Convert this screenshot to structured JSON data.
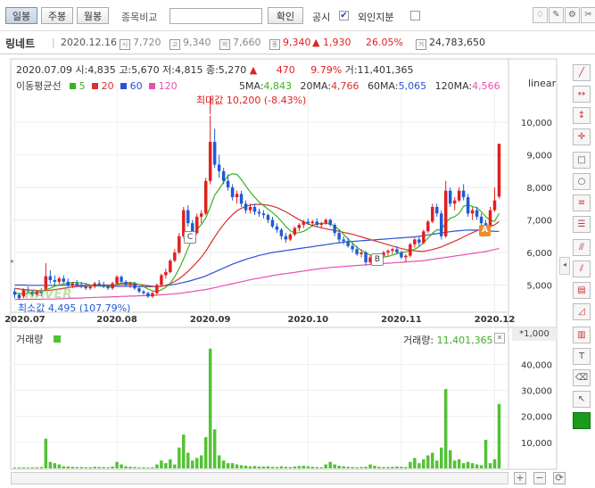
{
  "toolbar": {
    "period_buttons": [
      "일봉",
      "주봉",
      "월봉"
    ],
    "compare_label": "종목비교",
    "confirm_label": "확인",
    "disclosure_label": "공시",
    "foreign_label": "외인지분",
    "check_mark": "✔"
  },
  "info": {
    "name": "링네트",
    "date": "2020.12.16",
    "open": "7,720",
    "high": "9,340",
    "low": "7,660",
    "close": "9,340",
    "change": "▲ 1,930",
    "change_pct": "26.05%",
    "volume": "24,783,650",
    "icon_open": "시",
    "icon_high": "고",
    "icon_low": "저",
    "icon_volume": "거"
  },
  "legend": {
    "row1": {
      "date": "2020.07.09",
      "open_label": "시:",
      "open": "4,835",
      "high_label": "고:",
      "high": "5,670",
      "low_label": "저:",
      "low": "4,815",
      "close_label": "종:",
      "close": "5,270",
      "arrow": "▲",
      "change": "470",
      "change_pct": "9.79%",
      "volume_label": "거:",
      "volume": "11,401,365"
    },
    "ma_title": "이동평균선",
    "ma_items": [
      {
        "label": "5",
        "color": "#3cb021"
      },
      {
        "label": "20",
        "color": "#d83030"
      },
      {
        "label": "60",
        "color": "#2b50d8"
      },
      {
        "label": "120",
        "color": "#e84fb2"
      }
    ],
    "ma_values": [
      {
        "label": "5MA:",
        "value": "4,843",
        "color": "#3cb021"
      },
      {
        "label": "20MA:",
        "value": "4,766",
        "color": "#d83030"
      },
      {
        "label": "60MA:",
        "value": "5,065",
        "color": "#2b50d8"
      },
      {
        "label": "120MA:",
        "value": "4,566",
        "color": "#e84fb2"
      }
    ],
    "scale_type": "linear"
  },
  "annotations": {
    "max_label": "최대값 10,200 (-8.43%)",
    "min_label": "최소값 4,495 (107.79%)",
    "marker_a": "A",
    "marker_b": "B",
    "marker_c": "C",
    "watermark": "NAVER"
  },
  "volume_panel": {
    "title": "거래량",
    "value_label": "거래량:",
    "value": "11,401,365",
    "unit": "*1,000",
    "close_mark": "✕"
  },
  "colors": {
    "up": "#e02020",
    "down": "#1e5bd6",
    "ma5": "#3cb021",
    "ma20": "#d83030",
    "ma60": "#2b50d8",
    "ma120": "#e84fb2",
    "volume": "#52c234"
  },
  "chart_data": {
    "type": "candlestick",
    "x_tick_labels": [
      "2020.07",
      "2020.08",
      "2020.09",
      "2020.10",
      "2020.11",
      "2020.12"
    ],
    "x_tick_index": [
      0,
      23,
      44,
      66,
      87,
      108
    ],
    "y_ticks": [
      5000,
      6000,
      7000,
      8000,
      9000,
      10000
    ],
    "y_tick_labels": [
      "5,000",
      "6,000",
      "7,000",
      "8,000",
      "9,000",
      "10,000"
    ],
    "ylim": [
      4300,
      10800
    ],
    "candles": [
      [
        4800,
        4900,
        4600,
        4700
      ],
      [
        4700,
        4750,
        4550,
        4600
      ],
      [
        4650,
        4900,
        4600,
        4850
      ],
      [
        4850,
        4950,
        4750,
        4800
      ],
      [
        4800,
        4850,
        4650,
        4700
      ],
      [
        4700,
        4850,
        4650,
        4800
      ],
      [
        4800,
        4900,
        4650,
        4750
      ],
      [
        4835,
        5670,
        4815,
        5270
      ],
      [
        5270,
        5450,
        5050,
        5150
      ],
      [
        5150,
        5300,
        5000,
        5100
      ],
      [
        5100,
        5250,
        5000,
        5200
      ],
      [
        5200,
        5300,
        5050,
        5100
      ],
      [
        5100,
        5200,
        4950,
        5000
      ],
      [
        5000,
        5100,
        4900,
        5050
      ],
      [
        5050,
        5150,
        4950,
        5000
      ],
      [
        5000,
        5100,
        4900,
        4950
      ],
      [
        4950,
        5050,
        4850,
        4900
      ],
      [
        4900,
        5000,
        4850,
        4950
      ],
      [
        4950,
        5100,
        4900,
        5050
      ],
      [
        5050,
        5150,
        4950,
        5000
      ],
      [
        5000,
        5100,
        4900,
        4950
      ],
      [
        4950,
        5000,
        4850,
        4900
      ],
      [
        4900,
        5100,
        4850,
        5050
      ],
      [
        5050,
        5300,
        5000,
        5250
      ],
      [
        5250,
        5300,
        5050,
        5100
      ],
      [
        5100,
        5150,
        4950,
        5000
      ],
      [
        5000,
        5100,
        4900,
        5050
      ],
      [
        5050,
        5100,
        4850,
        4900
      ],
      [
        4900,
        4950,
        4750,
        4800
      ],
      [
        4800,
        4850,
        4700,
        4750
      ],
      [
        4750,
        4800,
        4600,
        4650
      ],
      [
        4650,
        4800,
        4600,
        4750
      ],
      [
        4750,
        5050,
        4700,
        5000
      ],
      [
        5000,
        5350,
        4950,
        5300
      ],
      [
        5300,
        5500,
        5200,
        5400
      ],
      [
        5400,
        5800,
        5350,
        5750
      ],
      [
        5750,
        6100,
        5700,
        6000
      ],
      [
        6000,
        6600,
        5950,
        6500
      ],
      [
        6500,
        7400,
        6450,
        7300
      ],
      [
        7300,
        7450,
        6800,
        6900
      ],
      [
        6900,
        7000,
        6500,
        6600
      ],
      [
        6600,
        7200,
        6550,
        7100
      ],
      [
        7100,
        7300,
        6900,
        7200
      ],
      [
        7200,
        8300,
        7150,
        8200
      ],
      [
        8200,
        10200,
        8100,
        9400
      ],
      [
        9400,
        9800,
        8600,
        8700
      ],
      [
        8700,
        9000,
        8300,
        8500
      ],
      [
        8500,
        8600,
        8100,
        8200
      ],
      [
        8200,
        8400,
        7900,
        8000
      ],
      [
        8000,
        8100,
        7600,
        7700
      ],
      [
        7700,
        7900,
        7500,
        7800
      ],
      [
        7800,
        7900,
        7400,
        7500
      ],
      [
        7500,
        7600,
        7200,
        7300
      ],
      [
        7300,
        7500,
        7200,
        7400
      ],
      [
        7400,
        7500,
        7150,
        7250
      ],
      [
        7250,
        7350,
        7100,
        7200
      ],
      [
        7200,
        7300,
        7050,
        7150
      ],
      [
        7150,
        7200,
        6900,
        7000
      ],
      [
        7000,
        7100,
        6750,
        6800
      ],
      [
        6800,
        6900,
        6600,
        6700
      ],
      [
        6700,
        6750,
        6400,
        6500
      ],
      [
        6500,
        6600,
        6300,
        6400
      ],
      [
        6400,
        6600,
        6350,
        6550
      ],
      [
        6550,
        6800,
        6500,
        6750
      ],
      [
        6750,
        6900,
        6650,
        6850
      ],
      [
        6850,
        7000,
        6750,
        6950
      ],
      [
        6950,
        7050,
        6850,
        6900
      ],
      [
        6900,
        7000,
        6800,
        6950
      ],
      [
        6950,
        7050,
        6800,
        6850
      ],
      [
        6850,
        6950,
        6750,
        6900
      ],
      [
        6900,
        7050,
        6850,
        7000
      ],
      [
        7000,
        7050,
        6800,
        6850
      ],
      [
        6850,
        6900,
        6500,
        6600
      ],
      [
        6600,
        6700,
        6300,
        6400
      ],
      [
        6400,
        6500,
        6250,
        6350
      ],
      [
        6350,
        6450,
        6150,
        6200
      ],
      [
        6200,
        6300,
        6000,
        6100
      ],
      [
        6100,
        6200,
        5900,
        5950
      ],
      [
        5950,
        6100,
        5850,
        6000
      ],
      [
        6000,
        6050,
        5600,
        5700
      ],
      [
        5700,
        5900,
        5650,
        5850
      ],
      [
        5850,
        5950,
        5750,
        5800
      ],
      [
        5800,
        5950,
        5750,
        5900
      ],
      [
        5900,
        6050,
        5850,
        6000
      ],
      [
        6000,
        6100,
        5900,
        6050
      ],
      [
        6050,
        6150,
        5950,
        6100
      ],
      [
        6100,
        6200,
        5950,
        6000
      ],
      [
        6000,
        6050,
        5800,
        5850
      ],
      [
        5850,
        5950,
        5700,
        5900
      ],
      [
        5900,
        6300,
        5850,
        6250
      ],
      [
        6250,
        6450,
        6150,
        6400
      ],
      [
        6400,
        6500,
        6200,
        6300
      ],
      [
        6300,
        6700,
        6250,
        6650
      ],
      [
        6650,
        7000,
        6600,
        6950
      ],
      [
        6950,
        7500,
        6900,
        7400
      ],
      [
        7400,
        7500,
        7100,
        7200
      ],
      [
        7200,
        7300,
        6400,
        6500
      ],
      [
        6500,
        8200,
        6450,
        7900
      ],
      [
        7900,
        8000,
        7400,
        7500
      ],
      [
        7500,
        7700,
        7300,
        7600
      ],
      [
        7600,
        8000,
        7550,
        7900
      ],
      [
        7900,
        8100,
        7600,
        7700
      ],
      [
        7700,
        7800,
        7100,
        7200
      ],
      [
        7200,
        7400,
        7000,
        7300
      ],
      [
        7300,
        7400,
        7000,
        7100
      ],
      [
        7100,
        7200,
        6850,
        6900
      ],
      [
        6900,
        7000,
        6700,
        6800
      ],
      [
        6800,
        7400,
        6750,
        7300
      ],
      [
        7300,
        8000,
        7250,
        7600
      ],
      [
        7720,
        9340,
        7660,
        9340
      ]
    ],
    "ma5": [
      4750,
      4740,
      4730,
      4750,
      4760,
      4780,
      4800,
      4850,
      4900,
      4960,
      5000,
      5030,
      5060,
      5080,
      5080,
      5060,
      5040,
      5000,
      4990,
      4980,
      4970,
      4960,
      4980,
      5030,
      5060,
      5070,
      5080,
      5060,
      5010,
      4950,
      4880,
      4820,
      4800,
      4850,
      4930,
      5060,
      5250,
      5500,
      5800,
      6130,
      6460,
      6700,
      6860,
      7060,
      7400,
      7760,
      7960,
      8160,
      8360,
      8420,
      8400,
      8240,
      8050,
      7860,
      7700,
      7550,
      7440,
      7330,
      7230,
      7110,
      6960,
      6800,
      6670,
      6600,
      6610,
      6650,
      6730,
      6830,
      6890,
      6890,
      6900,
      6880,
      6810,
      6700,
      6560,
      6420,
      6290,
      6160,
      6070,
      5990,
      5920,
      5870,
      5850,
      5860,
      5880,
      5920,
      5960,
      6000,
      6020,
      6060,
      6100,
      6180,
      6300,
      6440,
      6590,
      6700,
      6690,
      6920,
      7050,
      7100,
      7200,
      7420,
      7460,
      7410,
      7380,
      7250,
      7100,
      6990,
      6960,
      7200
    ],
    "ma20": [
      4900,
      4880,
      4860,
      4850,
      4840,
      4830,
      4820,
      4830,
      4840,
      4860,
      4880,
      4900,
      4920,
      4940,
      4950,
      4960,
      4970,
      4980,
      4990,
      5000,
      5000,
      5000,
      5000,
      5010,
      5020,
      5030,
      5030,
      5020,
      5010,
      5000,
      4980,
      4960,
      4950,
      4960,
      4990,
      5040,
      5110,
      5190,
      5300,
      5420,
      5560,
      5700,
      5860,
      6040,
      6260,
      6480,
      6680,
      6860,
      7020,
      7160,
      7280,
      7360,
      7420,
      7460,
      7480,
      7480,
      7470,
      7450,
      7420,
      7380,
      7320,
      7250,
      7170,
      7090,
      7010,
      6940,
      6880,
      6830,
      6790,
      6760,
      6730,
      6700,
      6680,
      6650,
      6620,
      6590,
      6560,
      6520,
      6480,
      6440,
      6400,
      6360,
      6320,
      6280,
      6240,
      6200,
      6160,
      6120,
      6090,
      6070,
      6050,
      6040,
      6040,
      6060,
      6090,
      6130,
      6170,
      6230,
      6290,
      6350,
      6410,
      6480,
      6550,
      6610,
      6670,
      6720,
      6760,
      6800,
      6850,
      6950
    ],
    "ma60": [
      5000,
      5000,
      5000,
      4990,
      4990,
      4990,
      4990,
      4990,
      4990,
      4990,
      4990,
      4990,
      4990,
      4990,
      4990,
      4990,
      4980,
      4980,
      4980,
      4970,
      4970,
      4960,
      4960,
      4960,
      4960,
      4960,
      4960,
      4960,
      4950,
      4950,
      4950,
      4950,
      4950,
      4960,
      4980,
      5000,
      5020,
      5050,
      5080,
      5110,
      5150,
      5190,
      5230,
      5280,
      5340,
      5400,
      5460,
      5520,
      5580,
      5640,
      5690,
      5740,
      5790,
      5830,
      5870,
      5910,
      5940,
      5970,
      6000,
      6020,
      6040,
      6060,
      6080,
      6100,
      6120,
      6140,
      6160,
      6180,
      6200,
      6220,
      6240,
      6260,
      6280,
      6300,
      6320,
      6330,
      6340,
      6350,
      6360,
      6370,
      6380,
      6390,
      6400,
      6410,
      6420,
      6430,
      6440,
      6450,
      6460,
      6470,
      6480,
      6500,
      6520,
      6540,
      6560,
      6580,
      6600,
      6620,
      6640,
      6660,
      6670,
      6680,
      6690,
      6690,
      6690,
      6680,
      6670,
      6660,
      6650,
      6650
    ],
    "ma120": [
      4560,
      4560,
      4560,
      4560,
      4560,
      4560,
      4560,
      4570,
      4570,
      4570,
      4580,
      4580,
      4590,
      4590,
      4600,
      4600,
      4610,
      4610,
      4620,
      4620,
      4630,
      4630,
      4640,
      4640,
      4650,
      4650,
      4660,
      4660,
      4670,
      4670,
      4680,
      4680,
      4690,
      4700,
      4710,
      4720,
      4730,
      4740,
      4760,
      4780,
      4800,
      4820,
      4840,
      4860,
      4890,
      4920,
      4950,
      4980,
      5010,
      5040,
      5070,
      5100,
      5130,
      5160,
      5190,
      5210,
      5240,
      5260,
      5290,
      5310,
      5330,
      5350,
      5370,
      5390,
      5410,
      5430,
      5450,
      5470,
      5490,
      5510,
      5520,
      5540,
      5550,
      5560,
      5570,
      5580,
      5590,
      5600,
      5610,
      5620,
      5630,
      5640,
      5650,
      5660,
      5670,
      5680,
      5690,
      5700,
      5710,
      5720,
      5730,
      5740,
      5750,
      5770,
      5790,
      5810,
      5830,
      5850,
      5870,
      5890,
      5910,
      5930,
      5950,
      5970,
      5990,
      6010,
      6030,
      6060,
      6090,
      6120
    ],
    "volume_ticks": [
      10000,
      20000,
      30000,
      40000
    ],
    "volume_tick_labels": [
      "10,000",
      "20,000",
      "30,000",
      "40,000"
    ],
    "volume_ylim": [
      0,
      47000
    ],
    "volume": [
      300,
      350,
      400,
      300,
      350,
      400,
      500,
      11401,
      2500,
      2000,
      1500,
      800,
      700,
      600,
      500,
      500,
      400,
      400,
      600,
      500,
      500,
      400,
      700,
      2500,
      1500,
      800,
      600,
      500,
      400,
      400,
      300,
      400,
      1500,
      3000,
      2000,
      3500,
      1500,
      8000,
      13000,
      6000,
      3000,
      4000,
      5000,
      12000,
      46000,
      15000,
      5000,
      3000,
      2000,
      2000,
      1500,
      1200,
      1000,
      800,
      900,
      700,
      700,
      800,
      600,
      500,
      800,
      600,
      500,
      700,
      900,
      1000,
      800,
      600,
      500,
      400,
      1500,
      2500,
      1500,
      1000,
      800,
      600,
      500,
      400,
      500,
      600,
      1500,
      1000,
      600,
      500,
      500,
      600,
      700,
      600,
      500,
      2500,
      4000,
      2000,
      3500,
      5000,
      6000,
      3000,
      8000,
      30500,
      7000,
      3000,
      3500,
      2000,
      2500,
      2000,
      1500,
      1200,
      11000,
      2000,
      3500,
      24783
    ]
  }
}
